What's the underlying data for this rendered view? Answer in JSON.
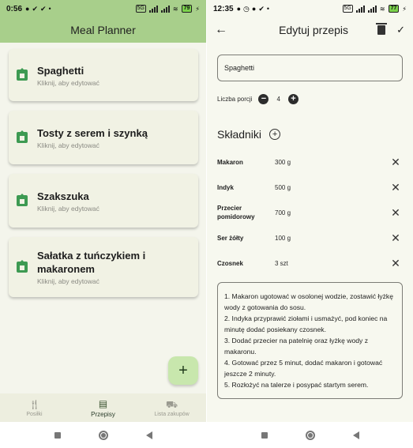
{
  "left": {
    "status": {
      "time": "0:56",
      "battery": "79"
    },
    "title": "Meal Planner",
    "recipes": [
      {
        "title": "Spaghetti",
        "subtitle": "Kliknij, aby edytować"
      },
      {
        "title": "Tosty z serem i szynką",
        "subtitle": "Kliknij, aby edytować"
      },
      {
        "title": "Szakszuka",
        "subtitle": "Kliknij, aby edytować"
      },
      {
        "title": "Sałatka z tuńczykiem i makaronem",
        "subtitle": "Kliknij, aby edytować"
      }
    ],
    "fab": "+",
    "nav": [
      {
        "label": "Posiłki",
        "icon": "fork-knife-icon"
      },
      {
        "label": "Przepisy",
        "icon": "book-icon",
        "active": true
      },
      {
        "label": "Lista zakupów",
        "icon": "basket-icon"
      }
    ]
  },
  "right": {
    "status": {
      "time": "12:35",
      "battery": "77"
    },
    "title": "Edytuj przepis",
    "recipe_name": "Spaghetti",
    "portions_label": "Liczba porcji",
    "portions_value": "4",
    "ingredients_title": "Składniki",
    "ingredients": [
      {
        "name": "Makaron",
        "qty": "300 g"
      },
      {
        "name": "Indyk",
        "qty": "500 g"
      },
      {
        "name": "Przecier pomidorowy",
        "qty": "700 g"
      },
      {
        "name": "Ser żółty",
        "qty": "100 g"
      },
      {
        "name": "Czosnek",
        "qty": "3 szt"
      }
    ],
    "steps": [
      "1. Makaron ugotować w osolonej wodzie, zostawić łyżkę wody z gotowania do sosu.",
      "2. Indyka przyprawić ziołami i usmażyć, pod koniec na minutę dodać posiekany czosnek.",
      "3. Dodać przecier na patelnię oraz łyżkę wody z makaronu.",
      "4. Gotować przez 5 minut, dodać makaron i gotować jeszcze 2 minuty.",
      "5. Rozłożyć na talerze i posypać startym serem."
    ]
  },
  "colors": {
    "accent": "#a8cf8b",
    "fab": "#c8e7ad",
    "card_icon": "#3d9a52"
  }
}
